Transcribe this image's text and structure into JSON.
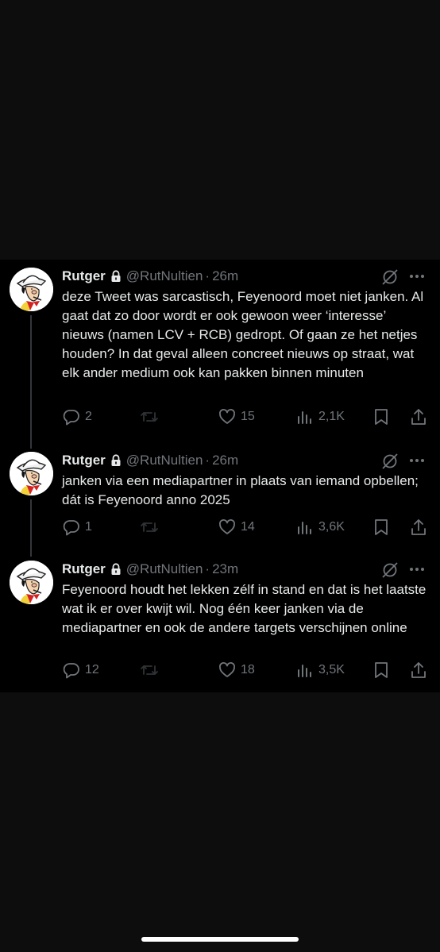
{
  "tweets": [
    {
      "name": "Rutger",
      "handle": "@RutNultien",
      "separator": "·",
      "time": "26m",
      "text": "deze Tweet was sarcastisch, Feyenoord moet niet janken. Al gaat dat zo door wordt er ook gewoon weer ‘interesse’ nieuws (namen LCV + RCB) gedropt. Of gaan ze het netjes houden? In dat geval alleen concreet nieuws op straat, wat elk ander medium ook kan pakken binnen minuten",
      "replies": "2",
      "retweets": "",
      "likes": "15",
      "views": "2,1K"
    },
    {
      "name": "Rutger",
      "handle": "@RutNultien",
      "separator": "·",
      "time": "26m",
      "text": "janken via een mediapartner in plaats van iemand opbellen; dát is Feyenoord anno 2025",
      "replies": "1",
      "retweets": "",
      "likes": "14",
      "views": "3,6K"
    },
    {
      "name": "Rutger",
      "handle": "@RutNultien",
      "separator": "·",
      "time": "23m",
      "text": "Feyenoord houdt het lekken zélf in stand en dat is het laatste wat ik er over kwijt wil. Nog één keer janken via de mediapartner en ook de andere targets verschijnen online",
      "replies": "12",
      "retweets": "",
      "likes": "18",
      "views": "3,5K"
    }
  ],
  "icons": {
    "lock": "lock-icon",
    "grok": "grok-icon",
    "more": "more-icon",
    "reply": "reply-icon",
    "retweet": "retweet-icon",
    "like": "like-icon",
    "views": "views-icon",
    "bookmark": "bookmark-icon",
    "share": "share-icon"
  },
  "colors": {
    "background": "#0e0d0e",
    "tweet_background": "#000000",
    "text": "#e7e9ea",
    "secondary": "#71767b"
  }
}
